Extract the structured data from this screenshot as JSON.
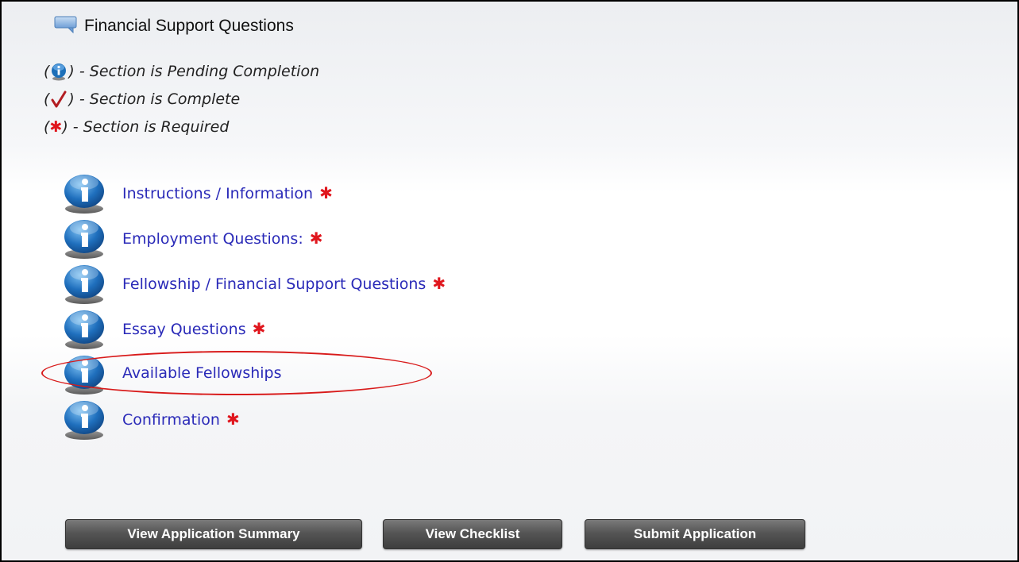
{
  "panel": {
    "title": "Financial Support Questions",
    "title_icon": "speech-bubble-icon"
  },
  "legend": [
    {
      "icon": "info-icon",
      "text": ") - Section is Pending Completion"
    },
    {
      "icon": "checkmark-icon",
      "text": ") - Section is Complete"
    },
    {
      "icon": "asterisk-icon",
      "text": ") - Section is Required"
    }
  ],
  "legend_open_paren": "(",
  "required_mark": "✱",
  "sections": [
    {
      "label": "Instructions / Information",
      "required": true,
      "status": "pending"
    },
    {
      "label": "Employment Questions:",
      "required": true,
      "status": "pending"
    },
    {
      "label": "Fellowship / Financial Support Questions",
      "required": true,
      "status": "pending"
    },
    {
      "label": "Essay Questions",
      "required": true,
      "status": "pending"
    },
    {
      "label": "Available Fellowships",
      "required": false,
      "status": "pending",
      "highlighted": true
    },
    {
      "label": "Confirmation",
      "required": true,
      "status": "pending"
    }
  ],
  "buttons": {
    "view_summary": "View Application Summary",
    "view_checklist": "View Checklist",
    "submit": "Submit Application"
  },
  "colors": {
    "link": "#2a2ab8",
    "required": "#e0161d",
    "info_blue": "#1d6fb8",
    "highlight": "#d81a1a",
    "button": "#4a4a4a"
  }
}
